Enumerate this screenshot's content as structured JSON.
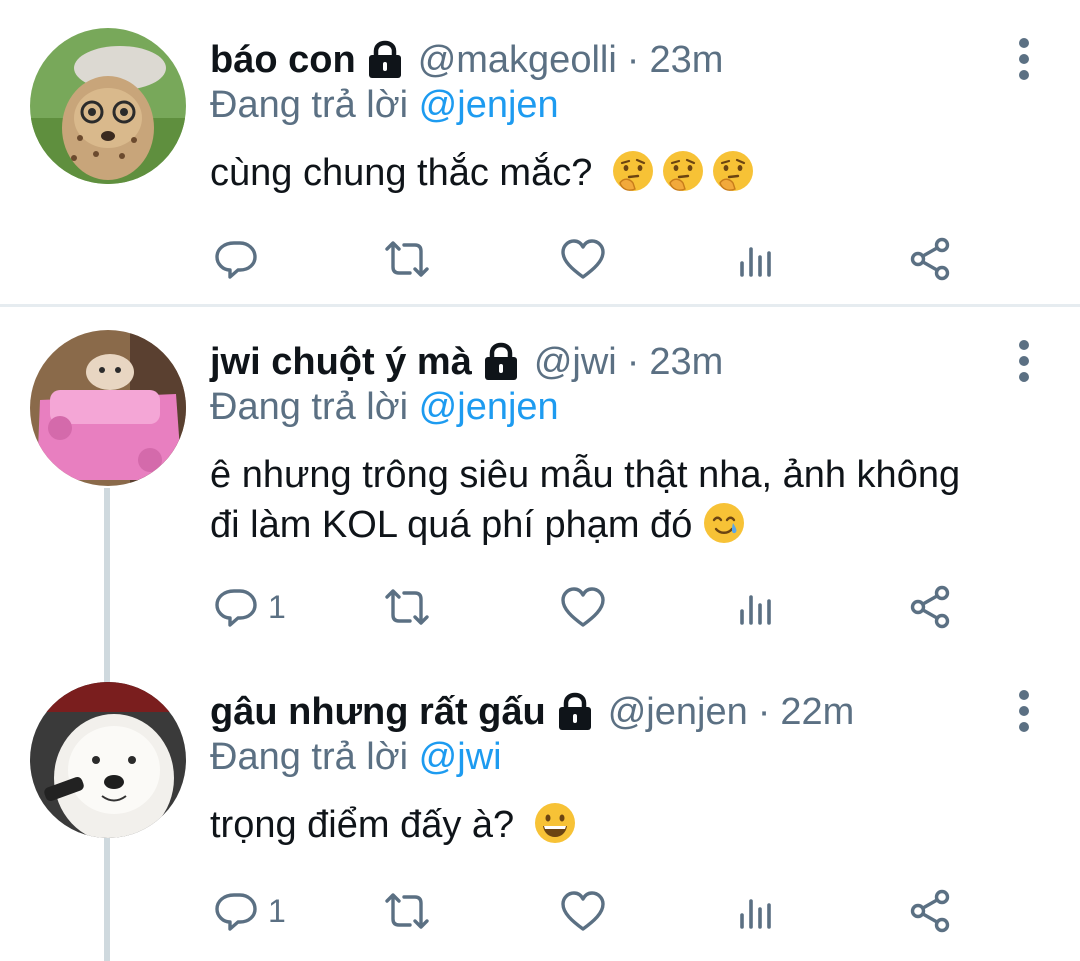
{
  "tweets": [
    {
      "name": "báo con",
      "handle": "@makgeolli",
      "sep": "·",
      "time": "23m",
      "replying_prefix": "Đang trả lời",
      "replying_to": "@jenjen",
      "text": "cùng chung thắc mắc?",
      "emoji": [
        "thinking-face",
        "thinking-face",
        "thinking-face"
      ],
      "reply_count": ""
    },
    {
      "name": "jwi chuột ý mà",
      "handle": "@jwi",
      "sep": "·",
      "time": "23m",
      "replying_prefix": "Đang trả lời",
      "replying_to": "@jenjen",
      "text_line1": "ê nhưng trông siêu mẫu thật nha, ảnh không",
      "text_line2": "đi làm KOL quá phí phạm đó",
      "emoji": [
        "smiling-face-with-tear"
      ],
      "reply_count": "1"
    },
    {
      "name": "gâu nhưng rất gấu",
      "handle": "@jenjen",
      "sep": "·",
      "time": "22m",
      "replying_prefix": "Đang trả lời",
      "replying_to": "@jwi",
      "text": "trọng điểm đấy à?",
      "emoji": [
        "grinning-face"
      ],
      "reply_count": "1"
    }
  ],
  "icons": [
    "lock-icon",
    "more-icon",
    "reply-icon",
    "retweet-icon",
    "like-icon",
    "analytics-icon",
    "share-icon"
  ],
  "colors": {
    "link": "#1d9bf0",
    "secondary": "#5b7083",
    "text": "#0f1419",
    "divider": "#e6ecf0"
  }
}
